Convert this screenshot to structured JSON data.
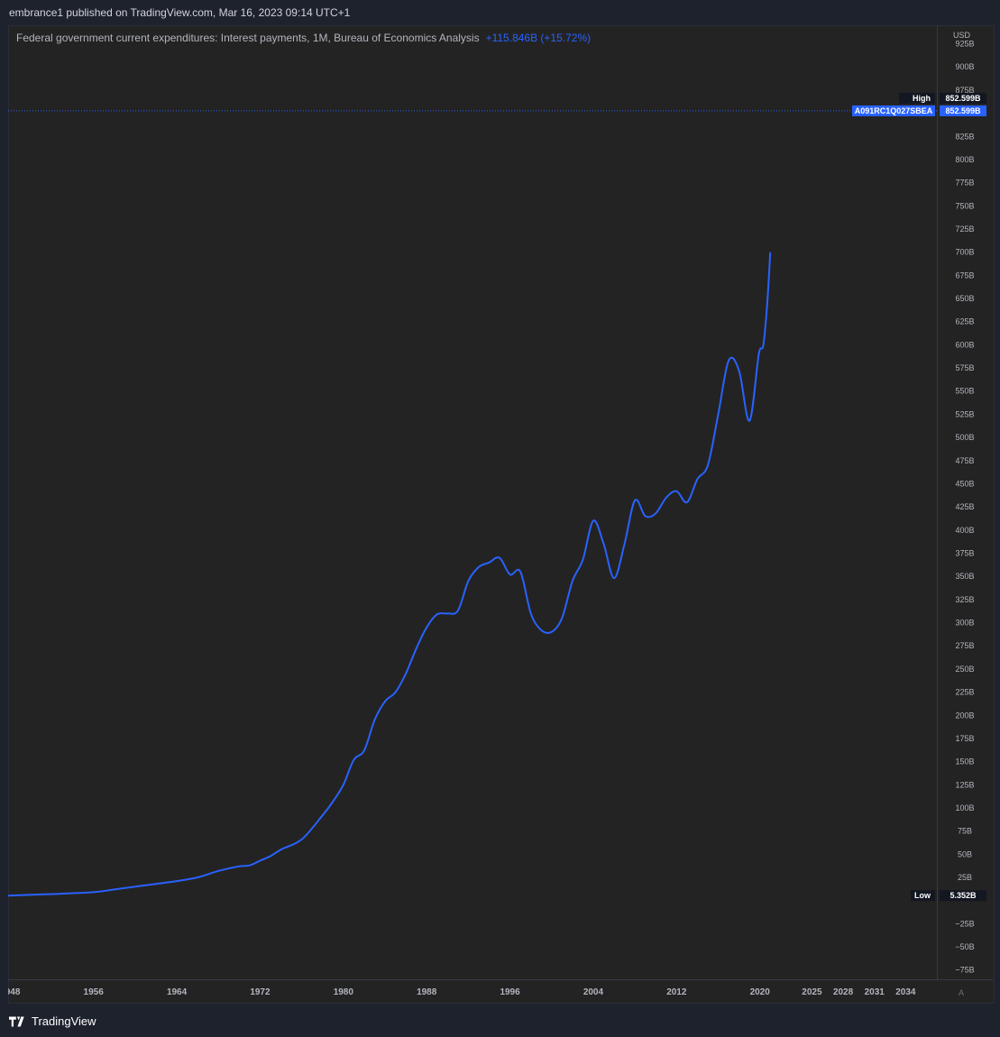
{
  "header": {
    "text": "embrance1 published on TradingView.com, Mar 16, 2023 09:14 UTC+1"
  },
  "legend": {
    "title": "Federal government current expenditures: Interest payments, 1M, Bureau of Economics Analysis",
    "change": "+115.846B (+15.72%)"
  },
  "footer": {
    "brand": "TradingView",
    "auto_label": "A"
  },
  "colors": {
    "line": "#2962ff",
    "background": "#232323",
    "panel": "#1e222d",
    "text": "#b2b5be"
  },
  "icons": {
    "logo": "tradingview-logo-icon"
  },
  "chart_data": {
    "type": "line",
    "title": "Federal government current expenditures: Interest payments, 1M, Bureau of Economics Analysis",
    "currency_label": "USD",
    "series_label": "A091RC1Q027SBEA",
    "high": {
      "label": "High",
      "value": 852.599,
      "text": "852.599B"
    },
    "low": {
      "label": "Low",
      "value": 5.352,
      "text": "5.352B"
    },
    "last": {
      "value": 852.599,
      "text": "852.599B"
    },
    "ylim": [
      -85,
      945
    ],
    "xlim": [
      1947.8,
      2037.0
    ],
    "y_ticks": [
      {
        "v": 925,
        "t": "925B"
      },
      {
        "v": 900,
        "t": "900B"
      },
      {
        "v": 875,
        "t": "875B"
      },
      {
        "v": 825,
        "t": "825B"
      },
      {
        "v": 800,
        "t": "800B"
      },
      {
        "v": 775,
        "t": "775B"
      },
      {
        "v": 750,
        "t": "750B"
      },
      {
        "v": 725,
        "t": "725B"
      },
      {
        "v": 700,
        "t": "700B"
      },
      {
        "v": 675,
        "t": "675B"
      },
      {
        "v": 650,
        "t": "650B"
      },
      {
        "v": 625,
        "t": "625B"
      },
      {
        "v": 600,
        "t": "600B"
      },
      {
        "v": 575,
        "t": "575B"
      },
      {
        "v": 550,
        "t": "550B"
      },
      {
        "v": 525,
        "t": "525B"
      },
      {
        "v": 500,
        "t": "500B"
      },
      {
        "v": 475,
        "t": "475B"
      },
      {
        "v": 450,
        "t": "450B"
      },
      {
        "v": 425,
        "t": "425B"
      },
      {
        "v": 400,
        "t": "400B"
      },
      {
        "v": 375,
        "t": "375B"
      },
      {
        "v": 350,
        "t": "350B"
      },
      {
        "v": 325,
        "t": "325B"
      },
      {
        "v": 300,
        "t": "300B"
      },
      {
        "v": 275,
        "t": "275B"
      },
      {
        "v": 250,
        "t": "250B"
      },
      {
        "v": 225,
        "t": "225B"
      },
      {
        "v": 200,
        "t": "200B"
      },
      {
        "v": 175,
        "t": "175B"
      },
      {
        "v": 150,
        "t": "150B"
      },
      {
        "v": 125,
        "t": "125B"
      },
      {
        "v": 100,
        "t": "100B"
      },
      {
        "v": 75,
        "t": "75B"
      },
      {
        "v": 50,
        "t": "50B"
      },
      {
        "v": 25,
        "t": "25B"
      },
      {
        "v": -25,
        "t": "−25B"
      },
      {
        "v": -50,
        "t": "−50B"
      },
      {
        "v": -75,
        "t": "−75B"
      }
    ],
    "x_ticks": [
      {
        "v": 1948,
        "t": "1948"
      },
      {
        "v": 1956,
        "t": "1956"
      },
      {
        "v": 1964,
        "t": "1964"
      },
      {
        "v": 1972,
        "t": "1972"
      },
      {
        "v": 1980,
        "t": "1980"
      },
      {
        "v": 1988,
        "t": "1988"
      },
      {
        "v": 1996,
        "t": "1996"
      },
      {
        "v": 2004,
        "t": "2004"
      },
      {
        "v": 2012,
        "t": "2012"
      },
      {
        "v": 2020,
        "t": "2020"
      },
      {
        "v": 2025,
        "t": "2025"
      },
      {
        "v": 2028,
        "t": "2028"
      },
      {
        "v": 2031,
        "t": "2031"
      },
      {
        "v": 2034,
        "t": "2034"
      }
    ],
    "x": [
      1947.8,
      1952,
      1956,
      1958,
      1960,
      1962,
      1964,
      1966,
      1968,
      1970,
      1971,
      1972,
      1973,
      1974,
      1976,
      1978,
      1979,
      1980,
      1981,
      1982,
      1983,
      1984,
      1985,
      1986,
      1987,
      1988,
      1989,
      1990,
      1991,
      1992,
      1993,
      1994,
      1995,
      1996,
      1997,
      1998,
      1999,
      2000,
      2001,
      2002,
      2003,
      2004,
      2005,
      2006,
      2007,
      2008,
      2009,
      2010,
      2011,
      2012,
      2013,
      2014,
      2015,
      2016,
      2017,
      2018,
      2019,
      2019.9,
      2020.4,
      2021.0,
      2021.5,
      2022.0,
      2022.5,
      2022.85
    ],
    "values": [
      5.352,
      7,
      9,
      12,
      15,
      18,
      21,
      25,
      32,
      37,
      38,
      43,
      48,
      55,
      66,
      92,
      107,
      125,
      152,
      162,
      195,
      215,
      225,
      245,
      272,
      295,
      309,
      310,
      313,
      345,
      360,
      365,
      370,
      352,
      355,
      310,
      292,
      290,
      305,
      345,
      368,
      410,
      385,
      348,
      385,
      432,
      415,
      418,
      435,
      442,
      430,
      455,
      470,
      525,
      583,
      572,
      518,
      590,
      605,
      700,
      852.599
    ]
  }
}
